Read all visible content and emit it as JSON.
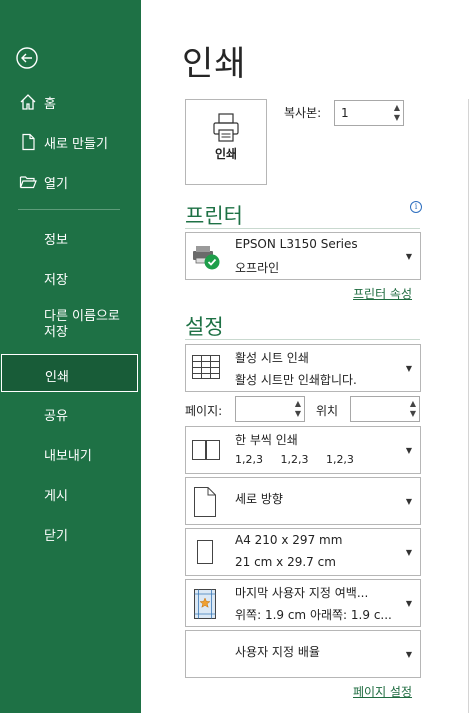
{
  "sidebar": {
    "back_label": "",
    "items": [
      {
        "label": "홈",
        "icon": "home-icon"
      },
      {
        "label": "새로 만들기",
        "icon": "new-document-icon"
      },
      {
        "label": "열기",
        "icon": "open-folder-icon"
      },
      {
        "label": "정보"
      },
      {
        "label": "저장"
      },
      {
        "label": "다른 이름으로\n저장"
      },
      {
        "label": "인쇄",
        "selected": true
      },
      {
        "label": "공유"
      },
      {
        "label": "내보내기"
      },
      {
        "label": "게시"
      },
      {
        "label": "닫기"
      }
    ]
  },
  "main": {
    "title": "인쇄",
    "print_button_label": "인쇄",
    "copies_label": "복사본:",
    "copies_value": "1",
    "printer_section": {
      "title": "프린터",
      "printer_name": "EPSON L3150 Series",
      "printer_status": "오프라인",
      "properties_link": "프린터 속성"
    },
    "settings_section": {
      "title": "설정",
      "scope": {
        "line1": "활성 시트 인쇄",
        "line2": "활성 시트만 인쇄합니다."
      },
      "pages_label": "페이지:",
      "to_label": "위치",
      "collation": {
        "line1": "한 부씩 인쇄",
        "line2": "1,2,3     1,2,3     1,2,3"
      },
      "orientation": {
        "line1": "세로 방향"
      },
      "paper_size": {
        "line1": "A4 210 x 297 mm",
        "line2": "21 cm x 29.7 cm"
      },
      "margins": {
        "line1": "마지막 사용자 지정 여백...",
        "line2": "위쪽: 1.9 cm 아래쪽: 1.9 c..."
      },
      "scaling": {
        "line1": "사용자 지정 배율"
      },
      "page_setup_link": "페이지 설정"
    }
  },
  "colors": {
    "sidebar_bg": "#1e7145",
    "selected_bg": "#185c38",
    "accent": "#1e7145"
  }
}
